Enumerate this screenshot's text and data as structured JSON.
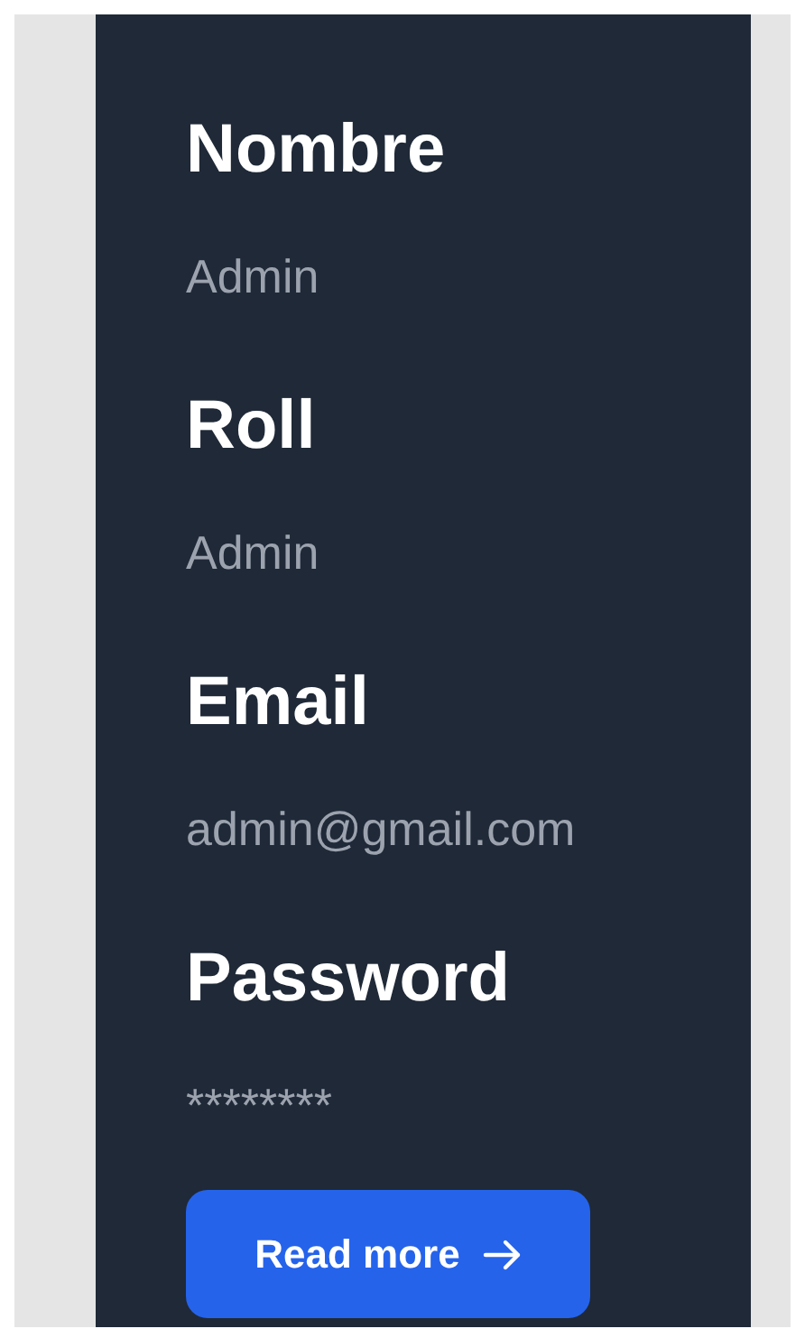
{
  "fields": [
    {
      "label": "Nombre",
      "value": "Admin"
    },
    {
      "label": "Roll",
      "value": "Admin"
    },
    {
      "label": "Email",
      "value": "admin@gmail.com"
    },
    {
      "label": "Password",
      "value": "********"
    }
  ],
  "button": {
    "label": "Read more"
  }
}
